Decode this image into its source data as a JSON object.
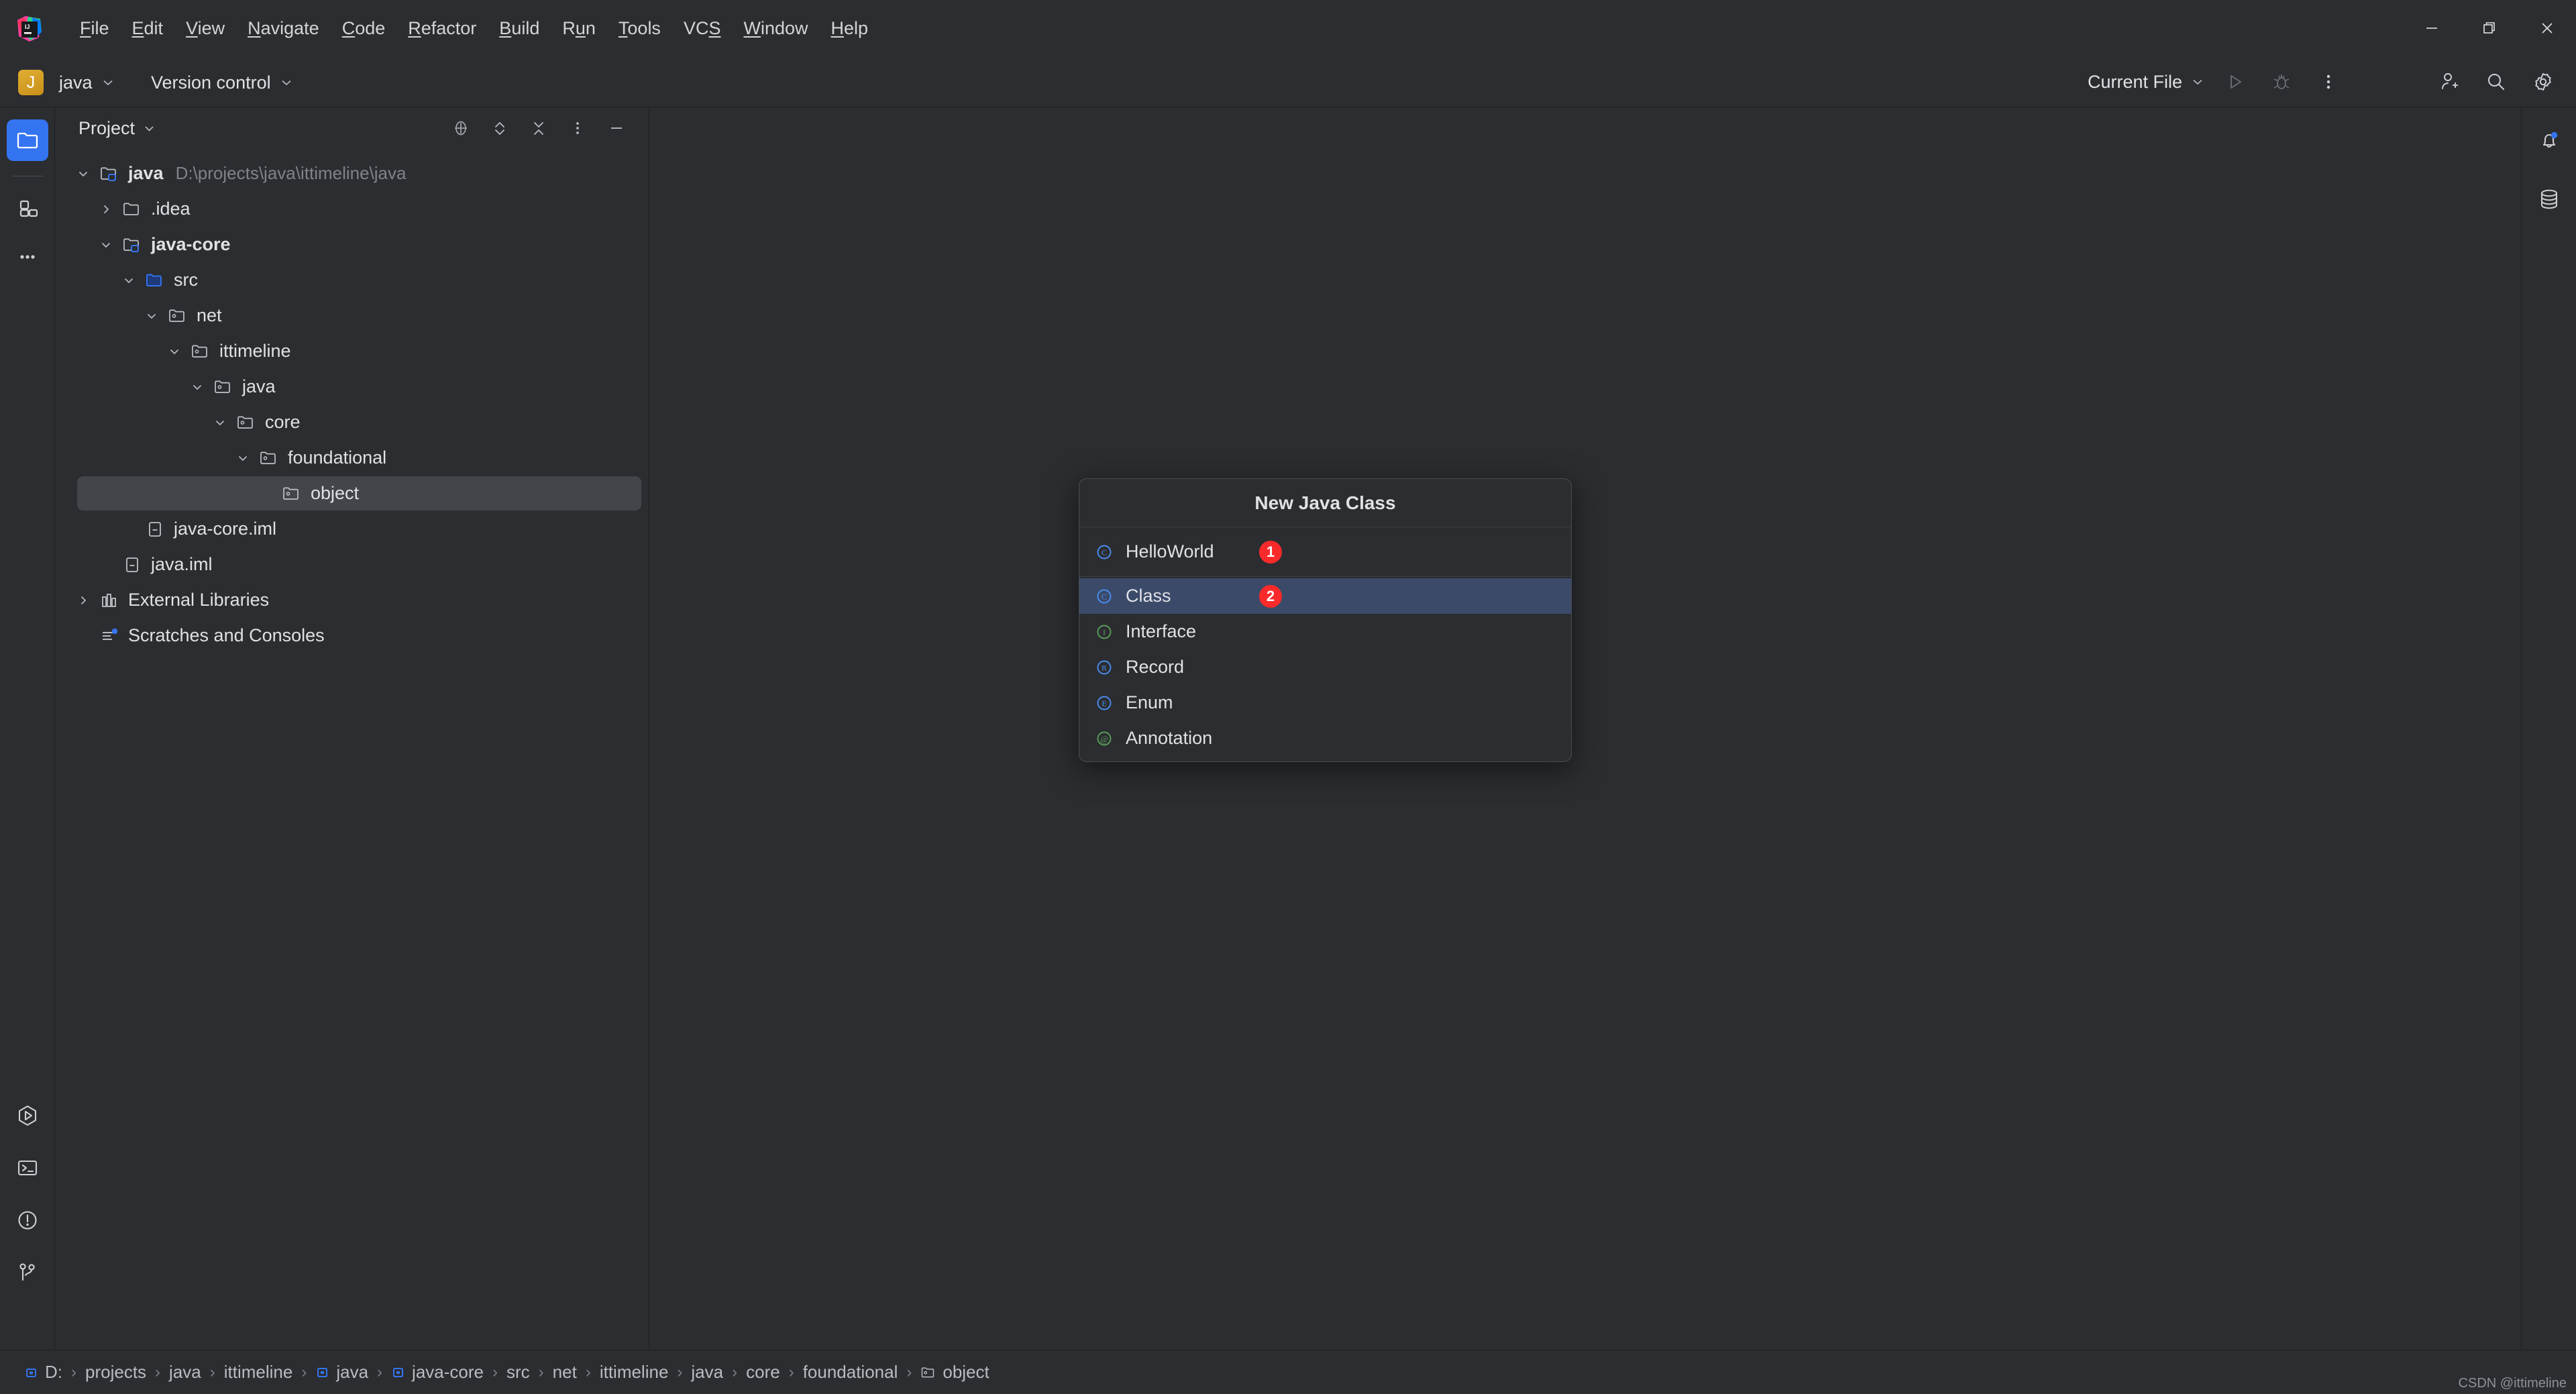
{
  "window": {
    "app_icon": "intellij-idea-logo",
    "controls": [
      {
        "name": "minimize-button",
        "icon": "minimize-icon"
      },
      {
        "name": "restore-button",
        "icon": "restore-icon"
      },
      {
        "name": "close-button",
        "icon": "close-icon"
      }
    ]
  },
  "menubar": {
    "items": [
      {
        "label": "File",
        "mnemonic": "F"
      },
      {
        "label": "Edit",
        "mnemonic": "E"
      },
      {
        "label": "View",
        "mnemonic": "V"
      },
      {
        "label": "Navigate",
        "mnemonic": "N"
      },
      {
        "label": "Code",
        "mnemonic": "C"
      },
      {
        "label": "Refactor",
        "mnemonic": "R"
      },
      {
        "label": "Build",
        "mnemonic": "B"
      },
      {
        "label": "Run",
        "mnemonic": "u"
      },
      {
        "label": "Tools",
        "mnemonic": "T"
      },
      {
        "label": "VCS",
        "mnemonic": "S"
      },
      {
        "label": "Window",
        "mnemonic": "W"
      },
      {
        "label": "Help",
        "mnemonic": "H"
      }
    ]
  },
  "toolbar": {
    "project_badge_letter": "J",
    "project_name": "java",
    "version_control_label": "Version control",
    "run_config_label": "Current File",
    "icons": {
      "run": "run-icon",
      "debug": "debug-icon",
      "more": "more-vertical-icon",
      "account": "add-user-icon",
      "search": "search-icon",
      "settings": "gear-icon"
    }
  },
  "left_activity_bar": {
    "top": [
      {
        "name": "project-tool-window",
        "icon": "folder-icon",
        "active": true
      },
      {
        "name": "structure-tool-window",
        "icon": "blocks-icon",
        "active": false
      },
      {
        "name": "more-tool-windows",
        "icon": "ellipsis-icon",
        "active": false
      }
    ],
    "bottom": [
      {
        "name": "run-tool-window",
        "icon": "run-hexagon-icon"
      },
      {
        "name": "terminal-tool-window",
        "icon": "terminal-icon"
      },
      {
        "name": "problems-tool-window",
        "icon": "warning-circle-icon"
      },
      {
        "name": "version-control-tool-window",
        "icon": "git-branch-icon"
      }
    ]
  },
  "right_activity_bar": {
    "items": [
      {
        "name": "notifications-tool-window",
        "icon": "bell-icon",
        "has_badge": true
      },
      {
        "name": "database-tool-window",
        "icon": "database-icon",
        "has_badge": false
      }
    ]
  },
  "project_panel": {
    "title": "Project",
    "actions": [
      {
        "name": "select-opened-file-button",
        "icon": "crosshair-icon"
      },
      {
        "name": "expand-all-button",
        "icon": "expand-icon"
      },
      {
        "name": "collapse-all-button",
        "icon": "collapse-icon"
      },
      {
        "name": "panel-options-button",
        "icon": "more-vertical-icon"
      },
      {
        "name": "hide-panel-button",
        "icon": "minus-icon"
      }
    ],
    "tree": [
      {
        "label": "java",
        "detail": "D:\\projects\\java\\ittimeline\\java",
        "indent": 0,
        "arrow": "down",
        "icon": "module-folder-icon",
        "bold": true,
        "selected": false
      },
      {
        "label": ".idea",
        "detail": "",
        "indent": 1,
        "arrow": "right",
        "icon": "folder-icon",
        "bold": false,
        "selected": false
      },
      {
        "label": "java-core",
        "detail": "",
        "indent": 1,
        "arrow": "down",
        "icon": "module-folder-icon",
        "bold": true,
        "selected": false
      },
      {
        "label": "src",
        "detail": "",
        "indent": 2,
        "arrow": "down",
        "icon": "source-root-icon",
        "bold": false,
        "selected": false
      },
      {
        "label": "net",
        "detail": "",
        "indent": 3,
        "arrow": "down",
        "icon": "package-icon",
        "bold": false,
        "selected": false
      },
      {
        "label": "ittimeline",
        "detail": "",
        "indent": 4,
        "arrow": "down",
        "icon": "package-icon",
        "bold": false,
        "selected": false
      },
      {
        "label": "java",
        "detail": "",
        "indent": 5,
        "arrow": "down",
        "icon": "package-icon",
        "bold": false,
        "selected": false
      },
      {
        "label": "core",
        "detail": "",
        "indent": 6,
        "arrow": "down",
        "icon": "package-icon",
        "bold": false,
        "selected": false
      },
      {
        "label": "foundational",
        "detail": "",
        "indent": 7,
        "arrow": "down",
        "icon": "package-icon",
        "bold": false,
        "selected": false
      },
      {
        "label": "object",
        "detail": "",
        "indent": 8,
        "arrow": "none",
        "icon": "package-icon",
        "bold": false,
        "selected": true
      },
      {
        "label": "java-core.iml",
        "detail": "",
        "indent": 2,
        "arrow": "none",
        "icon": "iml-file-icon",
        "bold": false,
        "selected": false
      },
      {
        "label": "java.iml",
        "detail": "",
        "indent": 1,
        "arrow": "none",
        "icon": "iml-file-icon",
        "bold": false,
        "selected": false
      },
      {
        "label": "External Libraries",
        "detail": "",
        "indent": 0,
        "arrow": "right",
        "icon": "libraries-icon",
        "bold": false,
        "selected": false
      },
      {
        "label": "Scratches and Consoles",
        "detail": "",
        "indent": 0,
        "arrow": "none",
        "icon": "scratches-icon",
        "bold": false,
        "selected": false
      }
    ]
  },
  "popup": {
    "title": "New Java Class",
    "name_input": {
      "value": "HelloWorld",
      "icon": "class-icon",
      "badge": "1"
    },
    "items": [
      {
        "label": "Class",
        "icon": "class-icon",
        "icon_color": "#4a8cf0",
        "selected": true,
        "badge": "2"
      },
      {
        "label": "Interface",
        "icon": "interface-icon",
        "icon_color": "#5a9e5a",
        "selected": false,
        "badge": ""
      },
      {
        "label": "Record",
        "icon": "record-icon",
        "icon_color": "#4a8cf0",
        "selected": false,
        "badge": ""
      },
      {
        "label": "Enum",
        "icon": "enum-icon",
        "icon_color": "#4a8cf0",
        "selected": false,
        "badge": ""
      },
      {
        "label": "Annotation",
        "icon": "annotation-icon",
        "icon_color": "#5a9e5a",
        "selected": false,
        "badge": ""
      }
    ]
  },
  "status_bar": {
    "breadcrumbs": [
      {
        "label": "D:",
        "icon": "drive-icon"
      },
      {
        "label": "projects",
        "icon": ""
      },
      {
        "label": "java",
        "icon": ""
      },
      {
        "label": "ittimeline",
        "icon": ""
      },
      {
        "label": "java",
        "icon": "module-mark-icon"
      },
      {
        "label": "java-core",
        "icon": "module-mark-icon"
      },
      {
        "label": "src",
        "icon": ""
      },
      {
        "label": "net",
        "icon": ""
      },
      {
        "label": "ittimeline",
        "icon": ""
      },
      {
        "label": "java",
        "icon": ""
      },
      {
        "label": "core",
        "icon": ""
      },
      {
        "label": "foundational",
        "icon": ""
      },
      {
        "label": "object",
        "icon": "package-icon"
      }
    ],
    "separator": "›",
    "watermark": "CSDN @ittimeline"
  },
  "colors": {
    "background": "#2b2d30",
    "border": "#1e1f22",
    "accent_blue": "#3574f0",
    "selection_blue": "#3b4a69",
    "selection_grey": "#43454a",
    "badge_red": "#fa2a2a",
    "text": "#dfe1e5",
    "muted_text": "#7f8389",
    "project_badge": "#c88f18"
  }
}
